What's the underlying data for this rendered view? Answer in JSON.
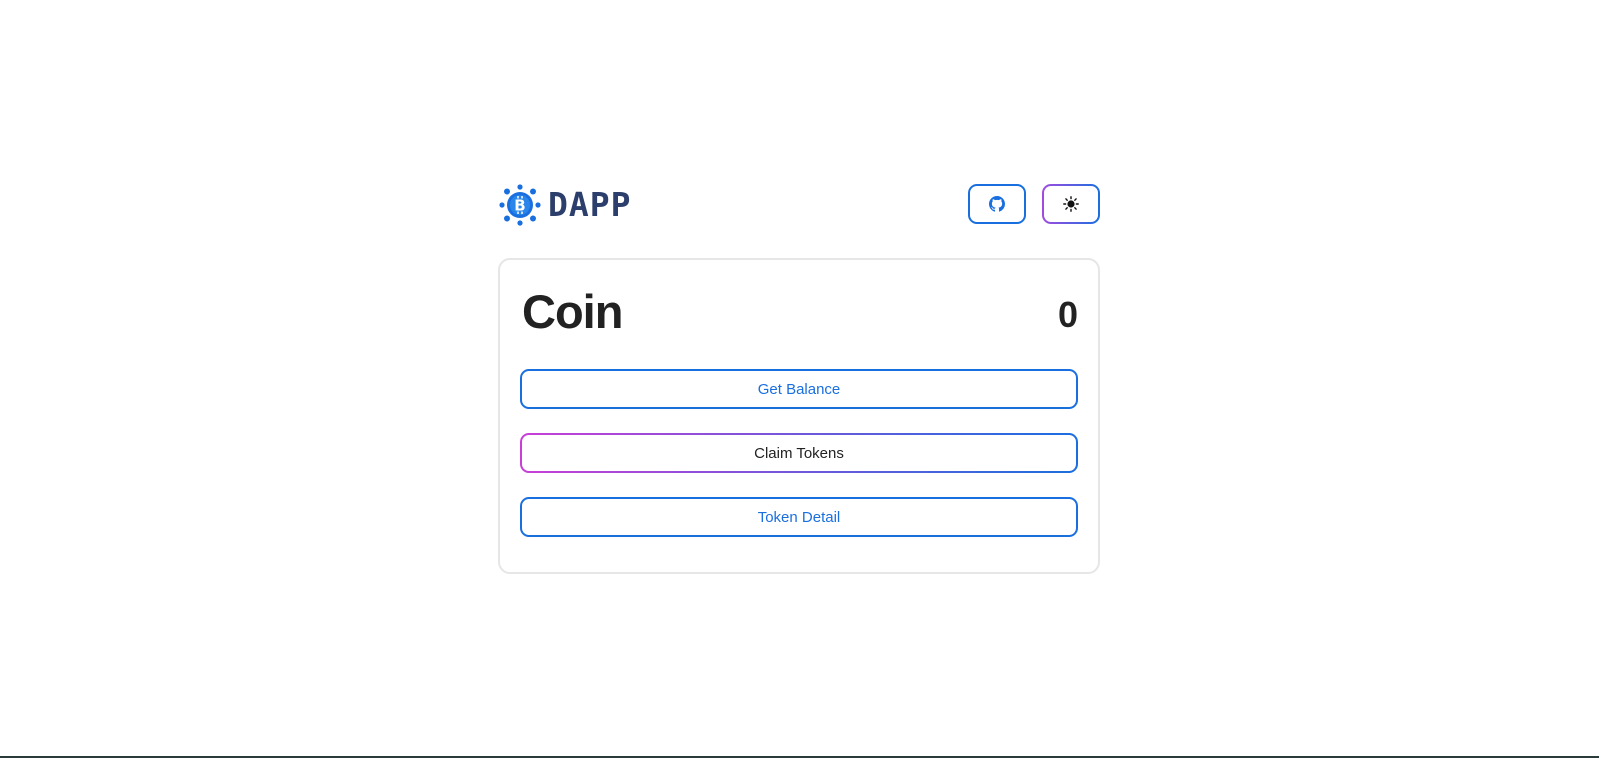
{
  "header": {
    "logo_text": "DAPP",
    "github_icon": "github-icon",
    "theme_icon": "sun-icon"
  },
  "card": {
    "title": "Coin",
    "balance": "0",
    "buttons": {
      "get_balance": "Get Balance",
      "claim_tokens": "Claim Tokens",
      "token_detail": "Token Detail"
    }
  },
  "colors": {
    "primary": "#1a6fe0",
    "gradient_start": "#c83fd6",
    "logo_text": "#2c3e6b",
    "card_border": "#e6e6e6",
    "text": "#222222"
  }
}
